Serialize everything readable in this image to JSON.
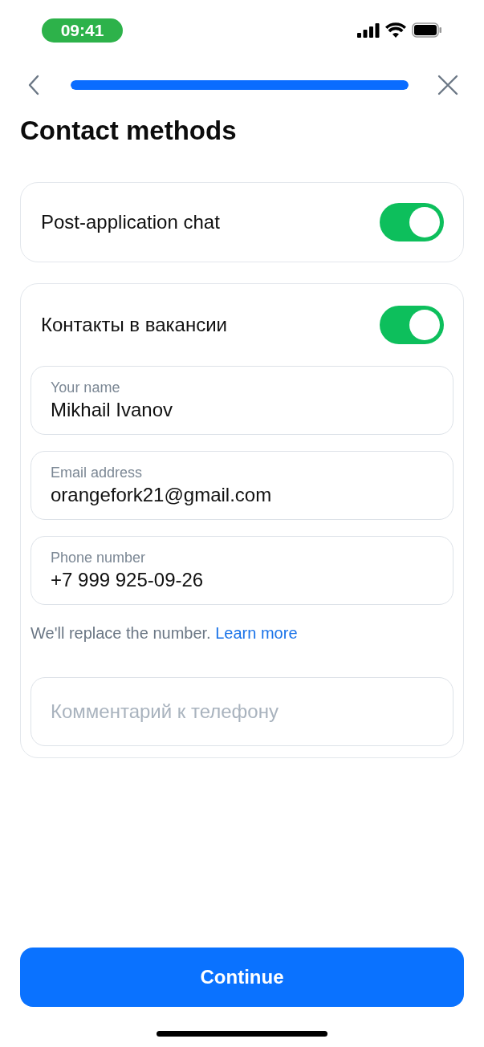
{
  "status_bar": {
    "time": "09:41"
  },
  "nav": {
    "progress": {
      "level": 1
    }
  },
  "title": "Contact methods",
  "chat_card": {
    "label": "Post-application chat",
    "on": true
  },
  "contacts_card": {
    "label": "Контакты в вакансии",
    "on": true,
    "fields": [
      {
        "label": "Your name",
        "value": "Mikhail Ivanov"
      },
      {
        "label": "Email address",
        "value": "orangefork21@gmail.com"
      },
      {
        "label": "Phone number",
        "value": "+7 999 925-09-26"
      }
    ],
    "hint": "We'll replace the number.",
    "hint_link": "Learn more",
    "comment": {
      "placeholder": "Комментарий к телефону"
    }
  },
  "continue_button": "Continue"
}
